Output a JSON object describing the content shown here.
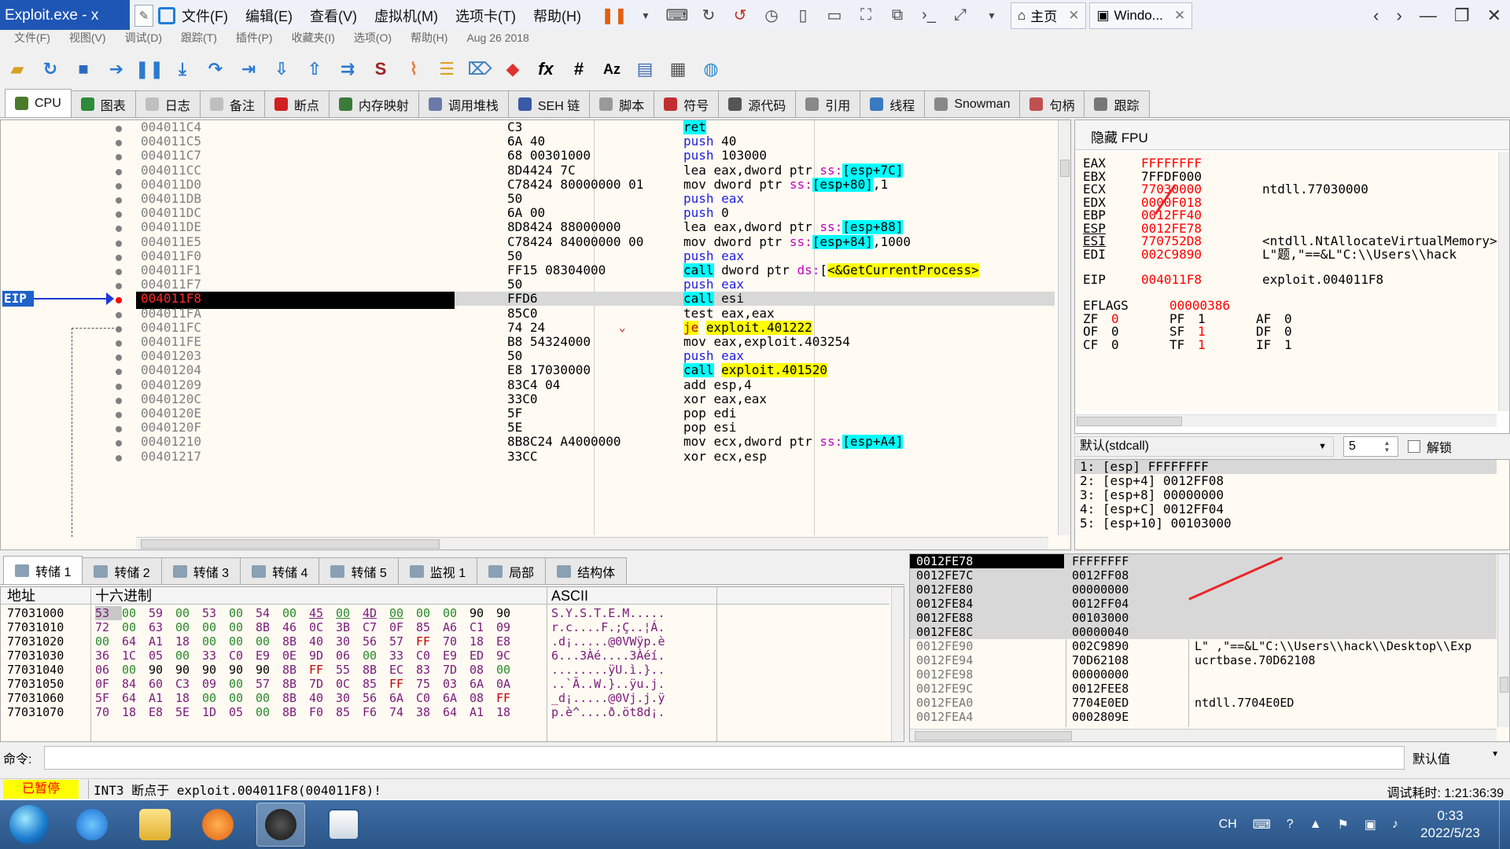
{
  "vm": {
    "app_title": "Exploit.exe - x",
    "menu": [
      "文件(F)",
      "编辑(E)",
      "查看(V)",
      "虚拟机(M)",
      "选项卡(T)",
      "帮助(H)"
    ],
    "tabs": [
      {
        "label": "主页",
        "icon": "home-icon"
      },
      {
        "label": "Windo...",
        "icon": "vm-window-icon"
      }
    ]
  },
  "x64dbg": {
    "menu_faded": [
      "文件(F)",
      "视图(V)",
      "调试(D)",
      "跟踪(T)",
      "插件(P)",
      "收藏夹(I)",
      "选项(O)",
      "帮助(H)",
      "Aug 26 2018"
    ],
    "tabs": [
      {
        "label": "CPU",
        "color": "#4a7a2a"
      },
      {
        "label": "图表",
        "color": "#2d8a3a"
      },
      {
        "label": "日志",
        "color": "#bfbfbf"
      },
      {
        "label": "备注",
        "color": "#bfbfbf"
      },
      {
        "label": "断点",
        "color": "#d02020"
      },
      {
        "label": "内存映射",
        "color": "#3a7a3a"
      },
      {
        "label": "调用堆栈",
        "color": "#6a7aa8"
      },
      {
        "label": "SEH 链",
        "color": "#3a5aa8"
      },
      {
        "label": "脚本",
        "color": "#999"
      },
      {
        "label": "符号",
        "color": "#c03030"
      },
      {
        "label": "源代码",
        "color": "#555"
      },
      {
        "label": "引用",
        "color": "#888"
      },
      {
        "label": "线程",
        "color": "#3a7ac0"
      },
      {
        "label": "Snowman",
        "color": "#888"
      },
      {
        "label": "句柄",
        "color": "#c05050"
      },
      {
        "label": "跟踪",
        "color": "#777"
      }
    ],
    "eip_label": "EIP",
    "disasm": [
      {
        "addr": "004011C4",
        "bytes": "C3",
        "asm": [
          [
            "k-ret",
            "ret"
          ]
        ]
      },
      {
        "addr": "004011C5",
        "bytes": "6A 40",
        "asm": [
          [
            "k-push",
            "push "
          ],
          [
            "num",
            "40"
          ]
        ]
      },
      {
        "addr": "004011C7",
        "bytes": "68 00301000",
        "asm": [
          [
            "k-push",
            "push "
          ],
          [
            "num",
            "103000"
          ]
        ]
      },
      {
        "addr": "004011CC",
        "bytes": "8D4424 7C",
        "asm": [
          [
            "k-lea",
            "lea eax,dword ptr "
          ],
          [
            "seg",
            "ss:"
          ],
          [
            "hl-cyan",
            "[esp+7C]"
          ]
        ]
      },
      {
        "addr": "004011D0",
        "bytes": "C78424 80000000 01",
        "asm": [
          [
            "k-mov",
            "mov dword ptr "
          ],
          [
            "seg",
            "ss:"
          ],
          [
            "hl-cyan",
            "[esp+80]"
          ],
          [
            "num",
            ",1"
          ]
        ]
      },
      {
        "addr": "004011DB",
        "bytes": "50",
        "asm": [
          [
            "k-push",
            "push eax"
          ]
        ]
      },
      {
        "addr": "004011DC",
        "bytes": "6A 00",
        "asm": [
          [
            "k-push",
            "push "
          ],
          [
            "num",
            "0"
          ]
        ]
      },
      {
        "addr": "004011DE",
        "bytes": "8D8424 88000000",
        "asm": [
          [
            "k-lea",
            "lea eax,dword ptr "
          ],
          [
            "seg",
            "ss:"
          ],
          [
            "hl-cyan",
            "[esp+88]"
          ]
        ]
      },
      {
        "addr": "004011E5",
        "bytes": "C78424 84000000 00",
        "asm": [
          [
            "k-mov",
            "mov dword ptr "
          ],
          [
            "seg",
            "ss:"
          ],
          [
            "hl-cyan",
            "[esp+84]"
          ],
          [
            "num",
            ",1000"
          ]
        ]
      },
      {
        "addr": "004011F0",
        "bytes": "50",
        "asm": [
          [
            "k-push",
            "push eax"
          ]
        ]
      },
      {
        "addr": "004011F1",
        "bytes": "FF15 08304000",
        "asm": [
          [
            "k-call",
            "call"
          ],
          [
            "k-mov",
            " dword ptr "
          ],
          [
            "seg",
            "ds:"
          ],
          [
            "num",
            "["
          ],
          [
            "hl-yel",
            "<&GetCurrentProcess>"
          ]
        ]
      },
      {
        "addr": "004011F7",
        "bytes": "50",
        "asm": [
          [
            "k-push",
            "push eax"
          ]
        ]
      },
      {
        "addr": "004011F8",
        "bytes": "FFD6",
        "asm": [
          [
            "k-call",
            "call"
          ],
          [
            "k-mov",
            " esi"
          ]
        ],
        "eip": true
      },
      {
        "addr": "004011FA",
        "bytes": "85C0",
        "asm": [
          [
            "k-test",
            "test eax,eax"
          ]
        ]
      },
      {
        "addr": "004011FC",
        "bytes": "74 24",
        "asm": [
          [
            "k-je",
            "je"
          ],
          [
            "k-mov",
            " "
          ],
          [
            "hl-yel",
            "exploit.401222"
          ]
        ],
        "jump": true
      },
      {
        "addr": "004011FE",
        "bytes": "B8 54324000",
        "asm": [
          [
            "k-mov",
            "mov eax,exploit.403254"
          ]
        ]
      },
      {
        "addr": "00401203",
        "bytes": "50",
        "asm": [
          [
            "k-push",
            "push eax"
          ]
        ]
      },
      {
        "addr": "00401204",
        "bytes": "E8 17030000",
        "asm": [
          [
            "k-call",
            "call"
          ],
          [
            "k-mov",
            " "
          ],
          [
            "hl-yel",
            "exploit.401520"
          ]
        ]
      },
      {
        "addr": "00401209",
        "bytes": "83C4 04",
        "asm": [
          [
            "k-add",
            "add esp,4"
          ]
        ]
      },
      {
        "addr": "0040120C",
        "bytes": "33C0",
        "asm": [
          [
            "k-xor",
            "xor eax,eax"
          ]
        ]
      },
      {
        "addr": "0040120E",
        "bytes": "5F",
        "asm": [
          [
            "k-pop",
            "pop edi"
          ]
        ]
      },
      {
        "addr": "0040120F",
        "bytes": "5E",
        "asm": [
          [
            "k-pop",
            "pop esi"
          ]
        ]
      },
      {
        "addr": "00401210",
        "bytes": "8B8C24 A4000000",
        "asm": [
          [
            "k-mov",
            "mov ecx,dword ptr "
          ],
          [
            "seg",
            "ss:"
          ],
          [
            "hl-cyan",
            "[esp+A4]"
          ]
        ]
      },
      {
        "addr": "00401217",
        "bytes": "33CC",
        "asm": [
          [
            "k-xor",
            "xor ecx,esp"
          ]
        ]
      }
    ],
    "registers": {
      "header": "隐藏 FPU",
      "gp": [
        {
          "name": "EAX",
          "value": "FFFFFFFF",
          "info": ""
        },
        {
          "name": "EBX",
          "value": "7FFDF000",
          "info": "",
          "black": true
        },
        {
          "name": "ECX",
          "value": "77030000",
          "info": "ntdll.77030000"
        },
        {
          "name": "EDX",
          "value": "0000F018",
          "info": ""
        },
        {
          "name": "EBP",
          "value": "0012FF40",
          "info": ""
        },
        {
          "name": "ESP",
          "value": "0012FE78",
          "info": "",
          "underline": true
        },
        {
          "name": "ESI",
          "value": "770752D8",
          "info": "<ntdll.NtAllocateVirtualMemory>",
          "underline": true
        },
        {
          "name": "EDI",
          "value": "002C9890",
          "info": "L\"题,\"==&L\"C:\\\\Users\\\\hack"
        }
      ],
      "eip": {
        "name": "EIP",
        "value": "004011F8",
        "info": "exploit.004011F8"
      },
      "eflags": {
        "name": "EFLAGS",
        "value": "00000386"
      },
      "flags": [
        [
          {
            "n": "ZF",
            "v": "0",
            "red": true
          },
          {
            "n": "PF",
            "v": "1"
          },
          {
            "n": "AF",
            "v": "0"
          }
        ],
        [
          {
            "n": "OF",
            "v": "0"
          },
          {
            "n": "SF",
            "v": "1",
            "red": true
          },
          {
            "n": "DF",
            "v": "0"
          }
        ],
        [
          {
            "n": "CF",
            "v": "0"
          },
          {
            "n": "TF",
            "v": "1",
            "red": true
          },
          {
            "n": "IF",
            "v": "1"
          }
        ]
      ]
    },
    "call_conv": {
      "select": "默认(stdcall)",
      "count": "5",
      "unlock": "解锁"
    },
    "args": [
      "1: [esp] FFFFFFFF",
      "2: [esp+4] 0012FF08",
      "3: [esp+8] 00000000",
      "4: [esp+C] 0012FF04",
      "5: [esp+10] 00103000"
    ],
    "dump_tabs": [
      "转储 1",
      "转储 2",
      "转储 3",
      "转储 4",
      "转储 5",
      "监视 1",
      "局部",
      "结构体"
    ],
    "dump_cols": {
      "addr": "地址",
      "hex": "十六进制",
      "ascii": "ASCII"
    },
    "dump": [
      {
        "addr": "77031000",
        "hex": [
          "53",
          "00",
          "59",
          "00",
          "53",
          "00",
          "54",
          "00",
          "45",
          "00",
          "4D",
          "00",
          "00",
          "00",
          "90",
          "90"
        ],
        "ascii": "S.Y.S.T.E.M....."
      },
      {
        "addr": "77031010",
        "hex": [
          "72",
          "00",
          "63",
          "00",
          "00",
          "00",
          "8B",
          "46",
          "0C",
          "3B",
          "C7",
          "0F",
          "85",
          "A6",
          "C1",
          "09"
        ],
        "ascii": "r.c....F.;Ç..¦Á."
      },
      {
        "addr": "77031020",
        "hex": [
          "00",
          "64",
          "A1",
          "18",
          "00",
          "00",
          "00",
          "8B",
          "40",
          "30",
          "56",
          "57",
          "FF",
          "70",
          "18",
          "E8"
        ],
        "ascii": ".d¡.....@0VWÿp.è"
      },
      {
        "addr": "77031030",
        "hex": [
          "36",
          "1C",
          "05",
          "00",
          "33",
          "C0",
          "E9",
          "0E",
          "9D",
          "06",
          "00",
          "33",
          "C0",
          "E9",
          "ED",
          "9C"
        ],
        "ascii": "6...3Àé....3Àéí."
      },
      {
        "addr": "77031040",
        "hex": [
          "06",
          "00",
          "90",
          "90",
          "90",
          "90",
          "90",
          "8B",
          "FF",
          "55",
          "8B",
          "EC",
          "83",
          "7D",
          "08",
          "00"
        ],
        "ascii": "........ÿU.ì.}.."
      },
      {
        "addr": "77031050",
        "hex": [
          "0F",
          "84",
          "60",
          "C3",
          "09",
          "00",
          "57",
          "8B",
          "7D",
          "0C",
          "85",
          "FF",
          "75",
          "03",
          "6A",
          "0A"
        ],
        "ascii": "..`Ã..W.}..ÿu.j."
      },
      {
        "addr": "77031060",
        "hex": [
          "5F",
          "64",
          "A1",
          "18",
          "00",
          "00",
          "00",
          "8B",
          "40",
          "30",
          "56",
          "6A",
          "C0",
          "6A",
          "08",
          "FF"
        ],
        "ascii": "_d¡.....@0Vj.j.ÿ"
      },
      {
        "addr": "77031070",
        "hex": [
          "70",
          "18",
          "E8",
          "5E",
          "1D",
          "05",
          "00",
          "8B",
          "F0",
          "85",
          "F6",
          "74",
          "38",
          "64",
          "A1",
          "18"
        ],
        "ascii": "p.è^....ð.öt8d¡."
      }
    ],
    "stack": [
      {
        "addr": "0012FE78",
        "val": "FFFFFFFF",
        "cmt": "",
        "cur": true
      },
      {
        "addr": "0012FE7C",
        "val": "0012FF08",
        "cmt": ""
      },
      {
        "addr": "0012FE80",
        "val": "00000000",
        "cmt": ""
      },
      {
        "addr": "0012FE84",
        "val": "0012FF04",
        "cmt": ""
      },
      {
        "addr": "0012FE88",
        "val": "00103000",
        "cmt": ""
      },
      {
        "addr": "0012FE8C",
        "val": "00000040",
        "cmt": ""
      },
      {
        "addr": "0012FE90",
        "val": "002C9890",
        "cmt": "L\" ,\"==&L\"C:\\\\Users\\\\hack\\\\Desktop\\\\Exp",
        "gray": true
      },
      {
        "addr": "0012FE94",
        "val": "70D62108",
        "cmt": "ucrtbase.70D62108",
        "gray": true
      },
      {
        "addr": "0012FE98",
        "val": "00000000",
        "cmt": "",
        "gray": true
      },
      {
        "addr": "0012FE9C",
        "val": "0012FEE8",
        "cmt": "",
        "gray": true
      },
      {
        "addr": "0012FEA0",
        "val": "7704E0ED",
        "cmt": "ntdll.7704E0ED",
        "gray": true
      },
      {
        "addr": "0012FEA4",
        "val": "0002809E",
        "cmt": "",
        "gray": true
      }
    ],
    "command": {
      "label": "命令:",
      "default": "默认值"
    },
    "status": {
      "paused": "已暂停",
      "message": "INT3 断点于 exploit.004011F8(004011F8)!",
      "time_label": "调试耗时:",
      "time": "1:21:36:39"
    }
  },
  "taskbar": {
    "tray": [
      "CH",
      "?"
    ],
    "time": "0:33",
    "date": "2022/5/23"
  }
}
